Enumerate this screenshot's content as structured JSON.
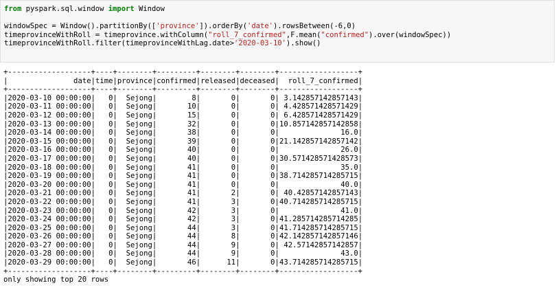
{
  "code_cell": {
    "import_line": {
      "kw_from": "from",
      "module": " pyspark.sql.window ",
      "kw_import": "import",
      "name": " Window"
    },
    "line2": {
      "a": "windowSpec = Window().partitionBy([",
      "s1": "'province'",
      "b": "]).orderBy(",
      "s2": "'date'",
      "c": ").rowsBetween(-6,0)"
    },
    "line3": {
      "a": "timeprovinceWithRoll = timeprovince.withColumn(",
      "s1": "\"roll_7_confirmed\"",
      "b": ",F.mean(",
      "s2": "\"confirmed\"",
      "c": ").over(windowSpec))"
    },
    "line4": {
      "a": "timeprovinceWithRoll.filter(timeprovinceWithLag.date>",
      "s1": "'2020-03-10'",
      "b": ").show()"
    }
  },
  "output": {
    "columns": [
      {
        "name": "date",
        "width": 19
      },
      {
        "name": "time",
        "width": 4
      },
      {
        "name": "province",
        "width": 8
      },
      {
        "name": "confirmed",
        "width": 9
      },
      {
        "name": "released",
        "width": 8
      },
      {
        "name": "deceased",
        "width": 8
      },
      {
        "name": "roll_7_confirmed",
        "width": 18
      }
    ],
    "rows": [
      [
        "2020-03-10 00:00:00",
        "0",
        "Sejong",
        "8",
        "0",
        "0",
        "3.142857142857143"
      ],
      [
        "2020-03-11 00:00:00",
        "0",
        "Sejong",
        "10",
        "0",
        "0",
        "4.428571428571429"
      ],
      [
        "2020-03-12 00:00:00",
        "0",
        "Sejong",
        "15",
        "0",
        "0",
        "6.428571428571429"
      ],
      [
        "2020-03-13 00:00:00",
        "0",
        "Sejong",
        "32",
        "0",
        "0",
        "10.857142857142858"
      ],
      [
        "2020-03-14 00:00:00",
        "0",
        "Sejong",
        "38",
        "0",
        "0",
        "16.0"
      ],
      [
        "2020-03-15 00:00:00",
        "0",
        "Sejong",
        "39",
        "0",
        "0",
        "21.142857142857142"
      ],
      [
        "2020-03-16 00:00:00",
        "0",
        "Sejong",
        "40",
        "0",
        "0",
        "26.0"
      ],
      [
        "2020-03-17 00:00:00",
        "0",
        "Sejong",
        "40",
        "0",
        "0",
        "30.571428571428573"
      ],
      [
        "2020-03-18 00:00:00",
        "0",
        "Sejong",
        "41",
        "0",
        "0",
        "35.0"
      ],
      [
        "2020-03-19 00:00:00",
        "0",
        "Sejong",
        "41",
        "0",
        "0",
        "38.714285714285715"
      ],
      [
        "2020-03-20 00:00:00",
        "0",
        "Sejong",
        "41",
        "0",
        "0",
        "40.0"
      ],
      [
        "2020-03-21 00:00:00",
        "0",
        "Sejong",
        "41",
        "2",
        "0",
        "40.42857142857143"
      ],
      [
        "2020-03-22 00:00:00",
        "0",
        "Sejong",
        "41",
        "3",
        "0",
        "40.714285714285715"
      ],
      [
        "2020-03-23 00:00:00",
        "0",
        "Sejong",
        "42",
        "3",
        "0",
        "41.0"
      ],
      [
        "2020-03-24 00:00:00",
        "0",
        "Sejong",
        "42",
        "3",
        "0",
        "41.285714285714285"
      ],
      [
        "2020-03-25 00:00:00",
        "0",
        "Sejong",
        "44",
        "3",
        "0",
        "41.714285714285715"
      ],
      [
        "2020-03-26 00:00:00",
        "0",
        "Sejong",
        "44",
        "8",
        "0",
        "42.142857142857146"
      ],
      [
        "2020-03-27 00:00:00",
        "0",
        "Sejong",
        "44",
        "9",
        "0",
        "42.57142857142857"
      ],
      [
        "2020-03-28 00:00:00",
        "0",
        "Sejong",
        "44",
        "9",
        "0",
        "43.0"
      ],
      [
        "2020-03-29 00:00:00",
        "0",
        "Sejong",
        "46",
        "11",
        "0",
        "43.714285714285715"
      ]
    ],
    "footer": "only showing top 20 rows"
  }
}
